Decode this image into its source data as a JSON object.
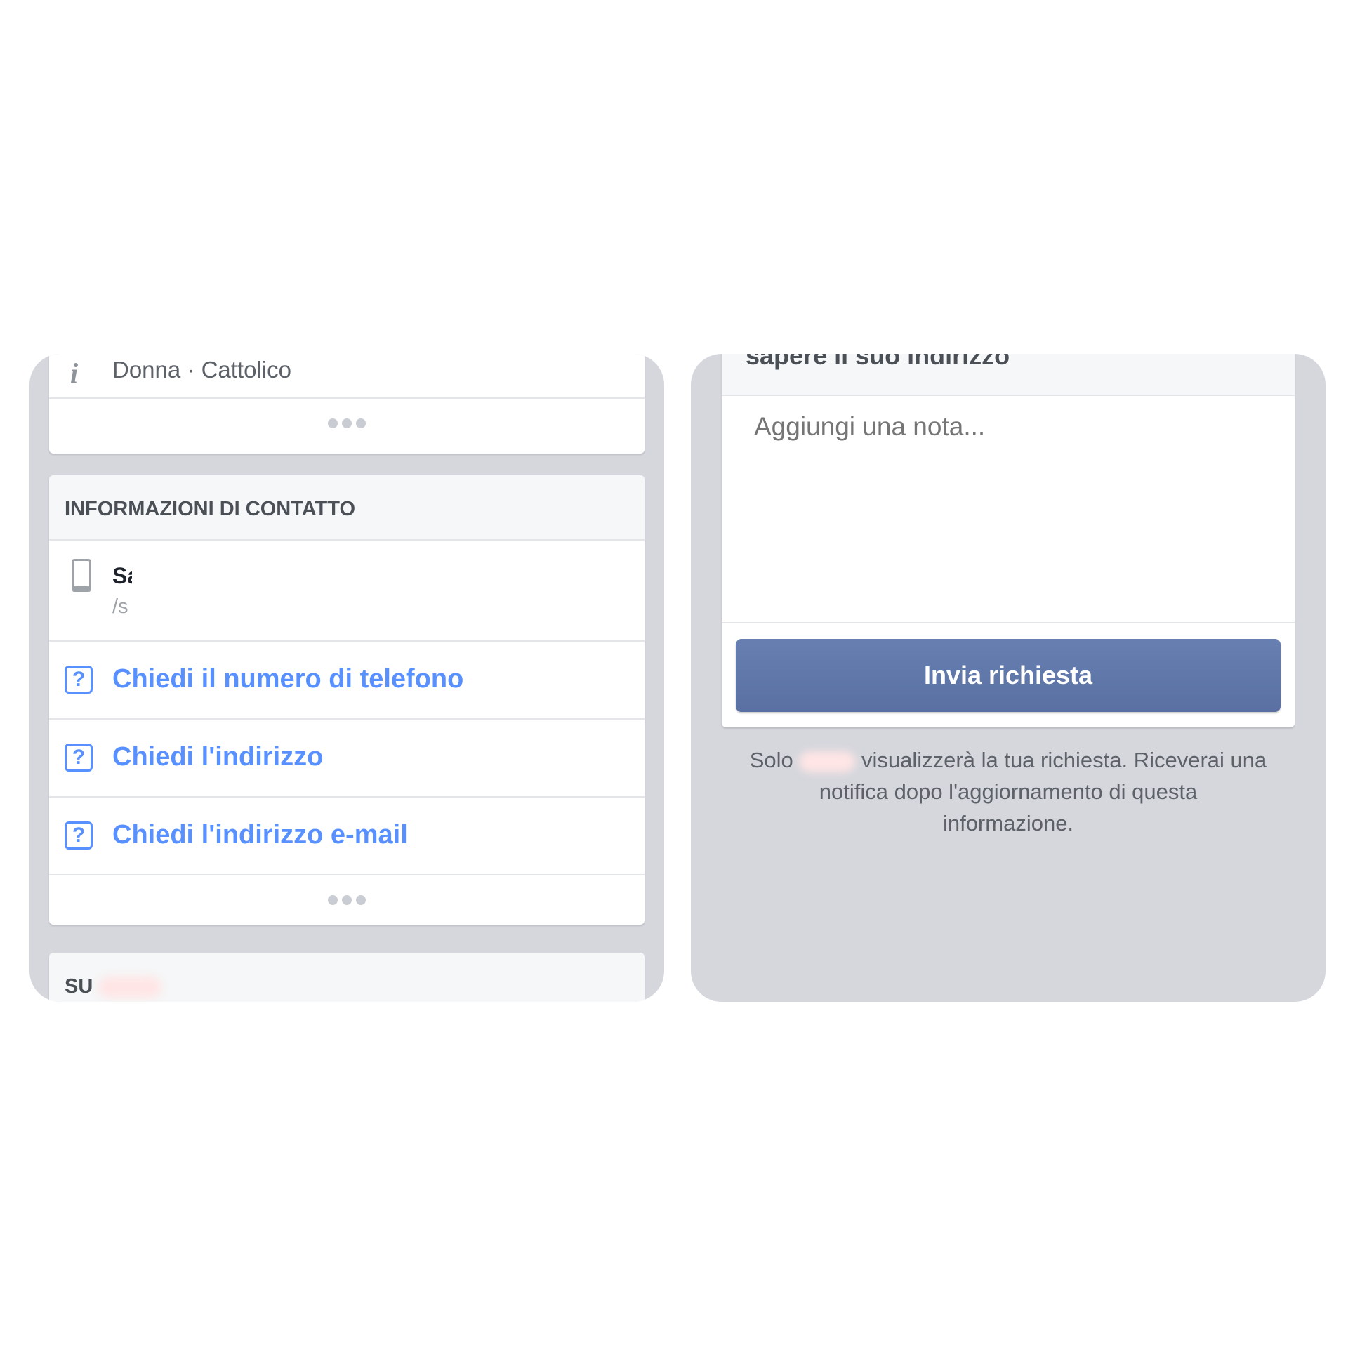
{
  "left": {
    "profile_line": "Donna · Cattolico",
    "contact_header": "INFORMAZIONI DI CONTATTO",
    "contact_name": "Sa",
    "contact_handle": "/s",
    "ask_phone": "Chiedi il numero di telefono",
    "ask_address": "Chiedi l'indirizzo",
    "ask_email": "Chiedi l'indirizzo e-mail",
    "about_header": "SU"
  },
  "right": {
    "cut_title": "sapere il suo indirizzo",
    "note_placeholder": "Aggiungi una nota...",
    "send_button": "Invia richiesta",
    "footer_prefix": "Solo",
    "footer_line1": "visualizzerà la tua richiesta. Riceverai una",
    "footer_line2": "notifica dopo l'aggiornamento di questa",
    "footer_line3": "informazione."
  },
  "colors": {
    "link": "#5890ff",
    "button": "#5f76a8",
    "background": "#d5d7dd"
  }
}
